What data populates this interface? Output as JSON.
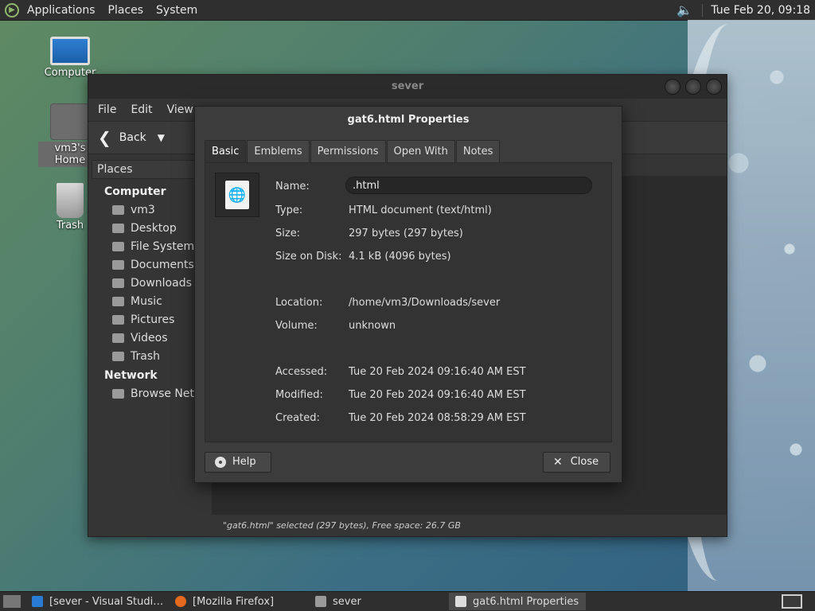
{
  "top_panel": {
    "menus": [
      "Applications",
      "Places",
      "System"
    ],
    "clock": "Tue Feb 20, 09:18",
    "speaker_icon": "speaker-icon"
  },
  "desktop_icons": [
    {
      "label": "Computer"
    },
    {
      "label": "vm3's Home"
    },
    {
      "label": "Trash"
    }
  ],
  "file_manager": {
    "title": "sever",
    "menu": [
      "File",
      "Edit",
      "View"
    ],
    "back_label": "Back",
    "places_label": "Places",
    "sidebar": {
      "computer_heading": "Computer",
      "computer_items": [
        "vm3",
        "Desktop",
        "File System",
        "Documents",
        "Downloads",
        "Music",
        "Pictures",
        "Videos",
        "Trash"
      ],
      "network_heading": "Network",
      "network_items": [
        "Browse Net…"
      ]
    },
    "status": "\"gat6.html\" selected (297 bytes), Free space: 26.7 GB"
  },
  "properties_dialog": {
    "title": "gat6.html Properties",
    "tabs": [
      "Basic",
      "Emblems",
      "Permissions",
      "Open With",
      "Notes"
    ],
    "active_tab": "Basic",
    "name_label": "Name:",
    "name_value": ".html",
    "type_label": "Type:",
    "type_value": "HTML document (text/html)",
    "size_label": "Size:",
    "size_value": "297 bytes (297 bytes)",
    "disk_label": "Size on Disk:",
    "disk_value": "4.1 kB (4096 bytes)",
    "location_label": "Location:",
    "location_value": "/home/vm3/Downloads/sever",
    "volume_label": "Volume:",
    "volume_value": "unknown",
    "accessed_label": "Accessed:",
    "accessed_value": "Tue 20 Feb 2024 09:16:40 AM EST",
    "modified_label": "Modified:",
    "modified_value": "Tue 20 Feb 2024 09:16:40 AM EST",
    "created_label": "Created:",
    "created_value": "Tue 20 Feb 2024 08:58:29 AM EST",
    "help_label": "Help",
    "close_label": "Close"
  },
  "taskbar": {
    "items": [
      "[sever - Visual Studi…",
      "[Mozilla Firefox]",
      "sever",
      "gat6.html Properties"
    ]
  }
}
